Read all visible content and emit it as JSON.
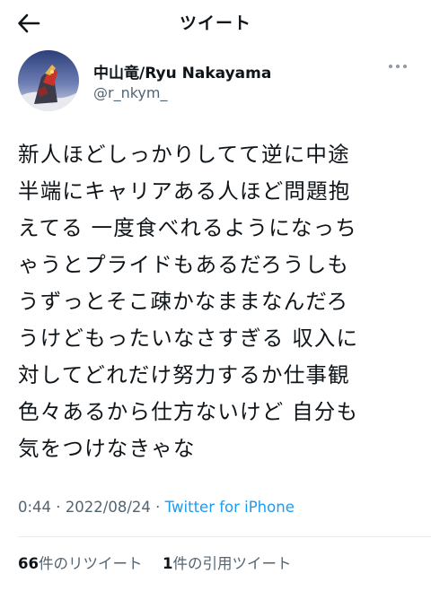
{
  "header": {
    "title": "ツイート",
    "back_icon": "arrow-left-icon"
  },
  "author": {
    "name": "中山竜/Ryu Nakayama",
    "handle": "@r_nkym_",
    "more_icon": "more-dots-icon"
  },
  "tweet": {
    "lines": [
      "新人ほどしっかりしてて逆に中途",
      "半端にキャリアある人ほど問題抱",
      "えてる 一度食べれるようになっち",
      "ゃうとプライドもあるだろうしも",
      "うずっとそこ疎かなままなんだろ",
      "うけどもったいなさすぎる 収入に",
      "対してどれだけ努力するか仕事観",
      "色々あるから仕方ないけど 自分も",
      "気をつけなきゃな"
    ]
  },
  "meta": {
    "time": "0:44",
    "separator": " · ",
    "date": "2022/08/24",
    "source": "Twitter for iPhone"
  },
  "stats": {
    "retweets_count": "66",
    "retweets_label": "件のリツイート",
    "quotes_count": "1",
    "quotes_label": "件の引用ツイート"
  },
  "colors": {
    "text": "#0f1419",
    "secondary": "#536471",
    "link": "#1d9bf0",
    "divider": "#e6ecf0"
  }
}
